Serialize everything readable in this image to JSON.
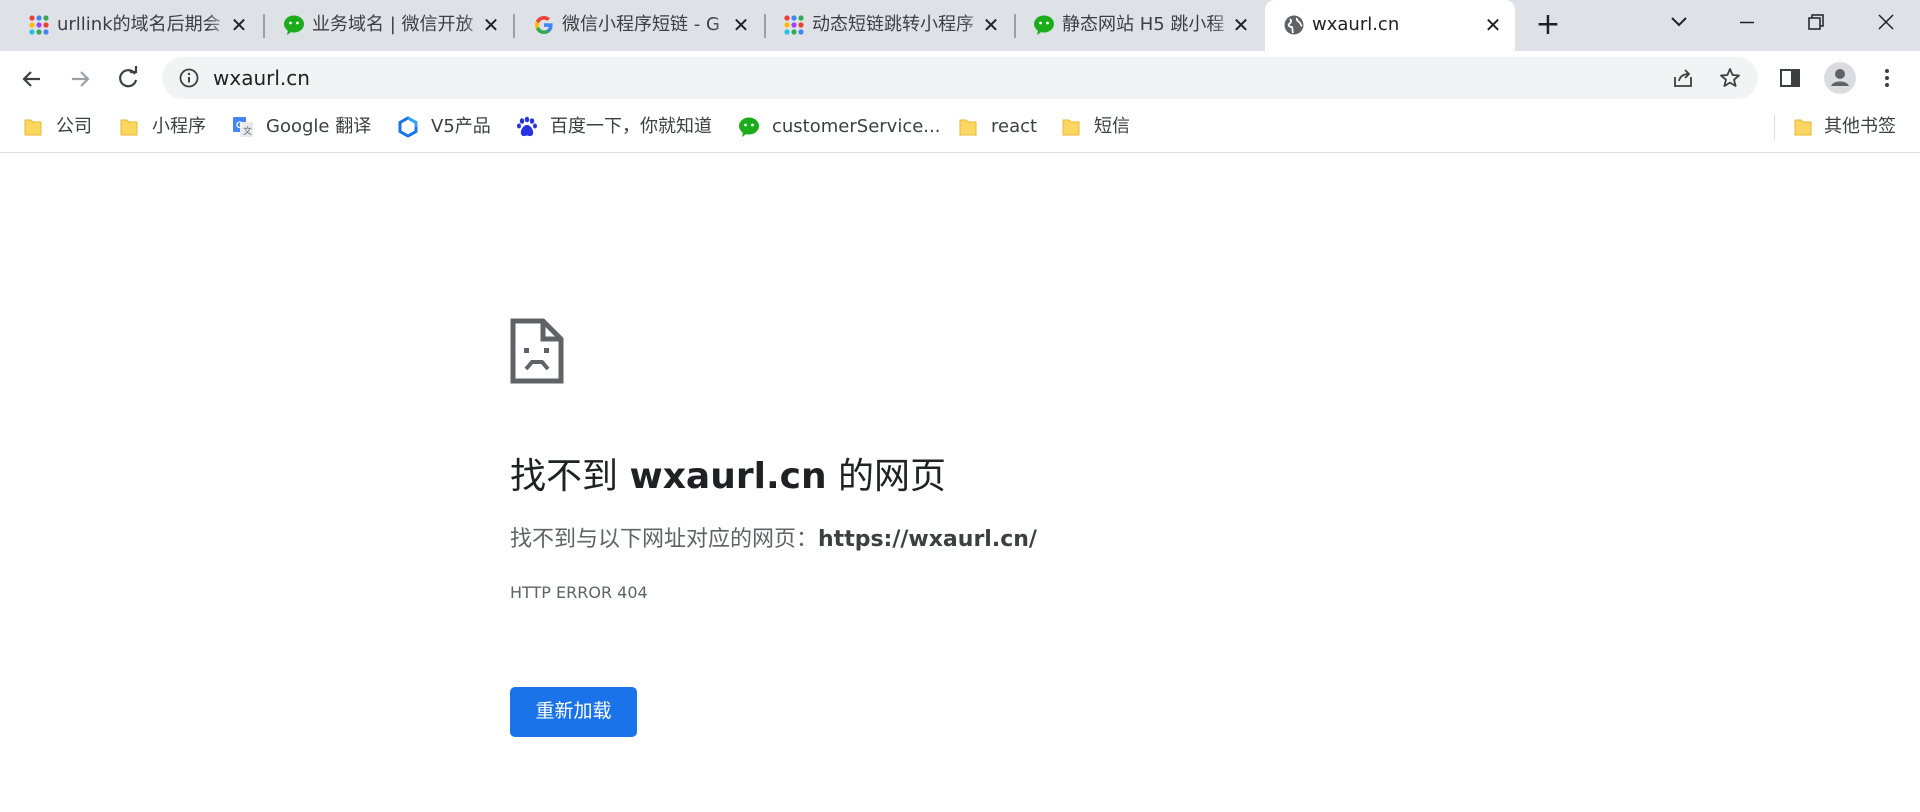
{
  "tabs": [
    {
      "title": "urllink的域名后期会",
      "favicon": "grid-dots-icon",
      "active": false
    },
    {
      "title": "业务域名 | 微信开放",
      "favicon": "wechat-icon",
      "active": false
    },
    {
      "title": "微信小程序短链 - G",
      "favicon": "google-icon",
      "active": false
    },
    {
      "title": "动态短链跳转小程序",
      "favicon": "grid-dots-icon",
      "active": false
    },
    {
      "title": "静态网站 H5 跳小程",
      "favicon": "wechat-icon",
      "active": false
    },
    {
      "title": "wxaurl.cn",
      "favicon": "globe-icon",
      "active": true
    }
  ],
  "close_glyph": "✕",
  "new_tab_glyph": "+",
  "omnibox": {
    "url": "wxaurl.cn"
  },
  "bookmarks": [
    {
      "label": "公司",
      "icon": "folder-icon"
    },
    {
      "label": "小程序",
      "icon": "folder-icon"
    },
    {
      "label": "Google 翻译",
      "icon": "google-translate-icon"
    },
    {
      "label": "V5产品",
      "icon": "v5-logo-icon"
    },
    {
      "label": "百度一下，你就知道",
      "icon": "baidu-icon"
    },
    {
      "label": "customerService...",
      "icon": "wechat-icon"
    },
    {
      "label": "react",
      "icon": "folder-icon"
    },
    {
      "label": "短信",
      "icon": "folder-icon"
    }
  ],
  "other_bookmarks": "其他书签",
  "error": {
    "title_prefix": "找不到 ",
    "title_host": "wxaurl.cn",
    "title_suffix": " 的网页",
    "desc_prefix": "找不到与以下网址对应的网页：",
    "desc_url": "https://wxaurl.cn/",
    "code": "HTTP ERROR 404",
    "reload_label": "重新加载"
  },
  "colors": {
    "tabstrip": "#dee1e6",
    "accent_button": "#1a73e8",
    "wechat_green": "#1aad19",
    "folder_yellow": "#fcd663"
  }
}
